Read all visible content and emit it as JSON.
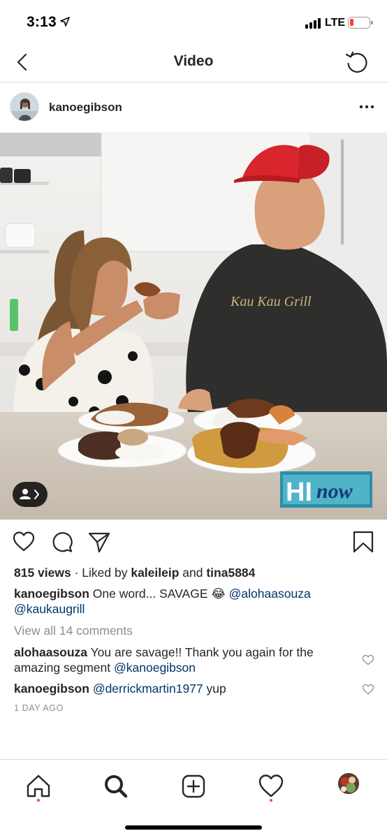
{
  "status_bar": {
    "time": "3:13",
    "carrier": "LTE"
  },
  "header": {
    "title": "Video"
  },
  "post": {
    "username": "kanoegibson",
    "video": {
      "shirt_text": "Kau Kau Grill",
      "logo_text": "HInow"
    },
    "views": "815 views",
    "liked_by_prefix": " · Liked by ",
    "liked_user_1": "kaleileip",
    "liked_and": " and ",
    "liked_user_2": "tina5884",
    "caption_user": "kanoegibson",
    "caption_text": " One word... SAVAGE 😂 ",
    "caption_mention_1": "@alohaasouza",
    "caption_mention_2": "@kaukaugrill",
    "view_all_comments": "View all 14 comments",
    "comments": [
      {
        "user": "alohaasouza",
        "text": " You are savage!! Thank you again for the amazing segment ",
        "mention": "@kanoegibson"
      },
      {
        "user": "kanoegibson",
        "text": " ",
        "mention": "@derrickmartin1977",
        "text_after": " yup"
      }
    ],
    "time_ago": "1 DAY AGO"
  },
  "colors": {
    "mention": "#003569",
    "muted": "#8e8e8e",
    "notification_dot": "#ed4956",
    "logo_bg": "#2b8fa8",
    "battery_low": "#ff3b30"
  },
  "icons": {
    "back": "chevron-left-icon",
    "refresh": "refresh-icon",
    "more": "more-dots-icon",
    "like": "heart-icon",
    "comment": "comment-icon",
    "share": "send-icon",
    "save": "bookmark-icon",
    "tag": "person-tag-icon",
    "tabs": [
      "home-icon",
      "search-icon",
      "new-post-icon",
      "activity-heart-icon",
      "profile-avatar-icon"
    ]
  }
}
